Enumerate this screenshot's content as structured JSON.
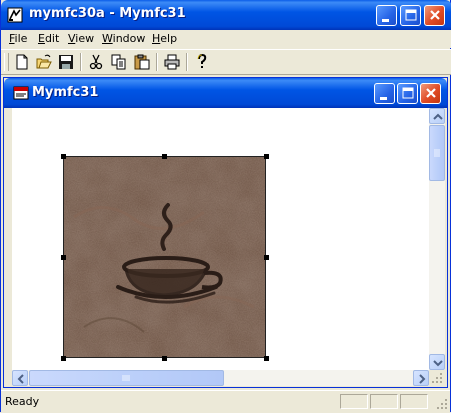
{
  "window": {
    "title": "mymfc30a - Mymfc31"
  },
  "menu": {
    "items": [
      {
        "key": "file",
        "label": "File"
      },
      {
        "key": "edit",
        "label": "Edit"
      },
      {
        "key": "view",
        "label": "View"
      },
      {
        "key": "window",
        "label": "Window"
      },
      {
        "key": "help",
        "label": "Help"
      }
    ]
  },
  "toolbar": {
    "buttons": [
      "new-icon",
      "open-icon",
      "save-icon",
      "cut-icon",
      "copy-icon",
      "paste-icon",
      "print-icon",
      "help-icon"
    ]
  },
  "child_window": {
    "title": "Mymfc31"
  },
  "document": {
    "image": "coffee-cup-picture"
  },
  "status_bar": {
    "text": "Ready"
  },
  "colors": {
    "title_blue": "#0055e5",
    "close_red": "#e04b25",
    "chrome": "#ece9d8"
  }
}
